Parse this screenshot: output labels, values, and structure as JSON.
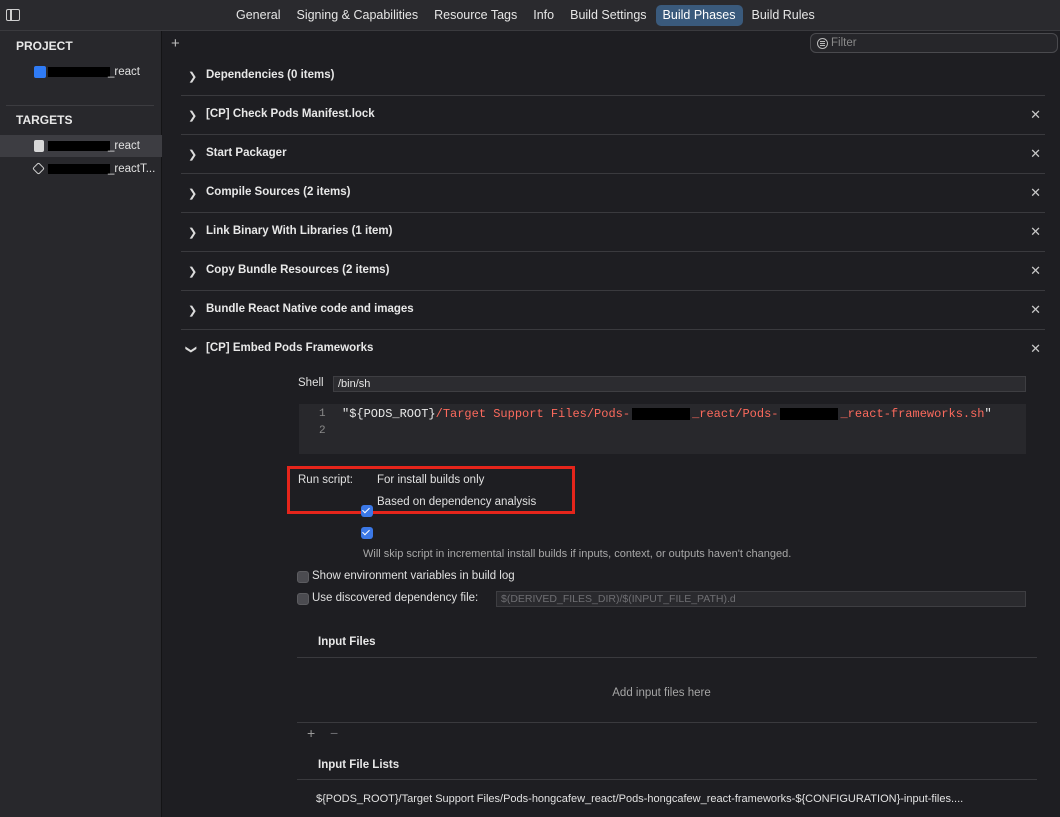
{
  "tabs": [
    "General",
    "Signing & Capabilities",
    "Resource Tags",
    "Info",
    "Build Settings",
    "Build Phases",
    "Build Rules"
  ],
  "active_tab": "Build Phases",
  "sidebar": {
    "project_heading": "PROJECT",
    "project_item": "_react",
    "targets_heading": "TARGETS",
    "targets": [
      {
        "label": "_react",
        "icon": "app-target-icon"
      },
      {
        "label": "_reactT...",
        "icon": "test-target-icon"
      }
    ]
  },
  "main": {
    "add_symbol": "+",
    "filter_placeholder": "Filter",
    "phases": [
      {
        "title": "Dependencies (0 items)",
        "removable": false
      },
      {
        "title": "[CP] Check Pods Manifest.lock",
        "removable": true
      },
      {
        "title": "Start Packager",
        "removable": true
      },
      {
        "title": "Compile Sources (2 items)",
        "removable": true
      },
      {
        "title": "Link Binary With Libraries (1 item)",
        "removable": true
      },
      {
        "title": "Copy Bundle Resources (2 items)",
        "removable": true
      },
      {
        "title": "Bundle React Native code and images",
        "removable": true
      },
      {
        "title": "[CP] Embed Pods Frameworks",
        "removable": true,
        "expanded": true
      }
    ],
    "embed": {
      "shell_label": "Shell",
      "shell_value": "/bin/sh",
      "code": {
        "line_numbers": [
          "1",
          "2"
        ],
        "open": "\"${PODS_ROOT}",
        "path_a": "/Target Support Files/Pods-",
        "path_b": "_react/Pods-",
        "path_c": "_react-frameworks.sh",
        "close": "\""
      },
      "run_script_label": "Run script:",
      "install_builds_only": {
        "label": "For install builds only",
        "checked": true
      },
      "dependency_analysis": {
        "label": "Based on dependency analysis",
        "checked": true
      },
      "hint": "Will skip script in incremental install builds if inputs, context, or outputs haven't changed.",
      "show_env": {
        "label": "Show environment variables in build log",
        "checked": false
      },
      "discovered_dep": {
        "label": "Use discovered dependency file:",
        "checked": false,
        "placeholder": "$(DERIVED_FILES_DIR)/$(INPUT_FILE_PATH).d"
      },
      "input_files_title": "Input Files",
      "input_files_empty": "Add input files here",
      "input_file_lists_title": "Input File Lists",
      "input_file_list_path": "${PODS_ROOT}/Target Support Files/Pods-hongcafew_react/Pods-hongcafew_react-frameworks-${CONFIGURATION}-input-files....",
      "plus": "+",
      "minus": "−"
    }
  }
}
